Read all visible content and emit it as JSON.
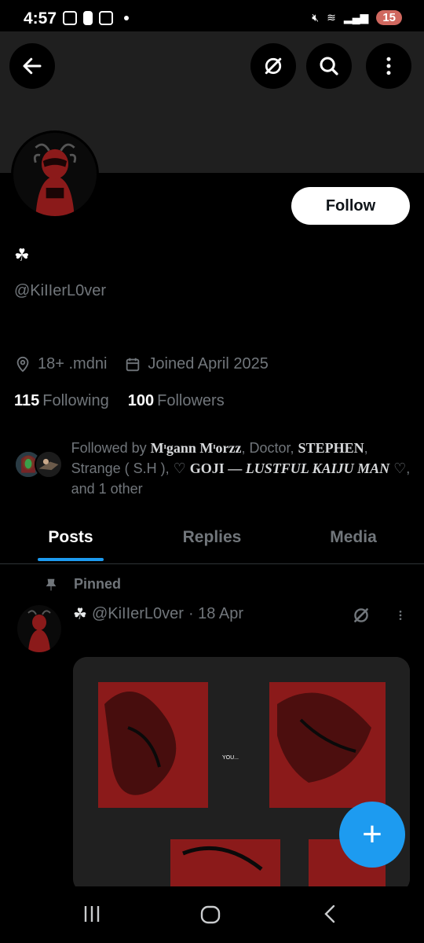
{
  "status_bar": {
    "time": "4:57",
    "battery": "15"
  },
  "header": {
    "back_icon": "arrow-left-icon",
    "grok_icon": "grok-icon",
    "search_icon": "search-icon",
    "more_icon": "more-vertical-icon"
  },
  "profile": {
    "display_name": "☘",
    "handle": "@KiIIerL0ver",
    "follow_label": "Follow",
    "location": "18+ .mdni",
    "joined": "Joined April 2025",
    "following_count": "115",
    "following_label": "Following",
    "followers_count": "100",
    "followers_label": "Followers"
  },
  "followed_by": {
    "prefix": "Followed by ",
    "name1": "Mᶦgann Mᶦorzz",
    "sep1": ", Doctor, ",
    "name2": "STEPHEN",
    "sep2": ", Strange ( S.H ), ♡ ",
    "name3": "GOJI — ",
    "name3b": "LUSTFUL KAIJU MAN",
    "suffix": " ♡, and 1 other"
  },
  "tabs": [
    {
      "label": "Posts",
      "active": true
    },
    {
      "label": "Replies",
      "active": false
    },
    {
      "label": "Media",
      "active": false
    }
  ],
  "pinned_post": {
    "pinned_label": "Pinned",
    "author_name": "☘",
    "handle": "@KiIIerL0ver",
    "date": "· 18 Apr",
    "image_caption": "YOU..."
  },
  "fab": {
    "label": "+"
  },
  "colors": {
    "accent": "#1d9bf0",
    "background": "#000000",
    "muted_text": "#71767b",
    "manga_red": "#8b1a1a"
  }
}
